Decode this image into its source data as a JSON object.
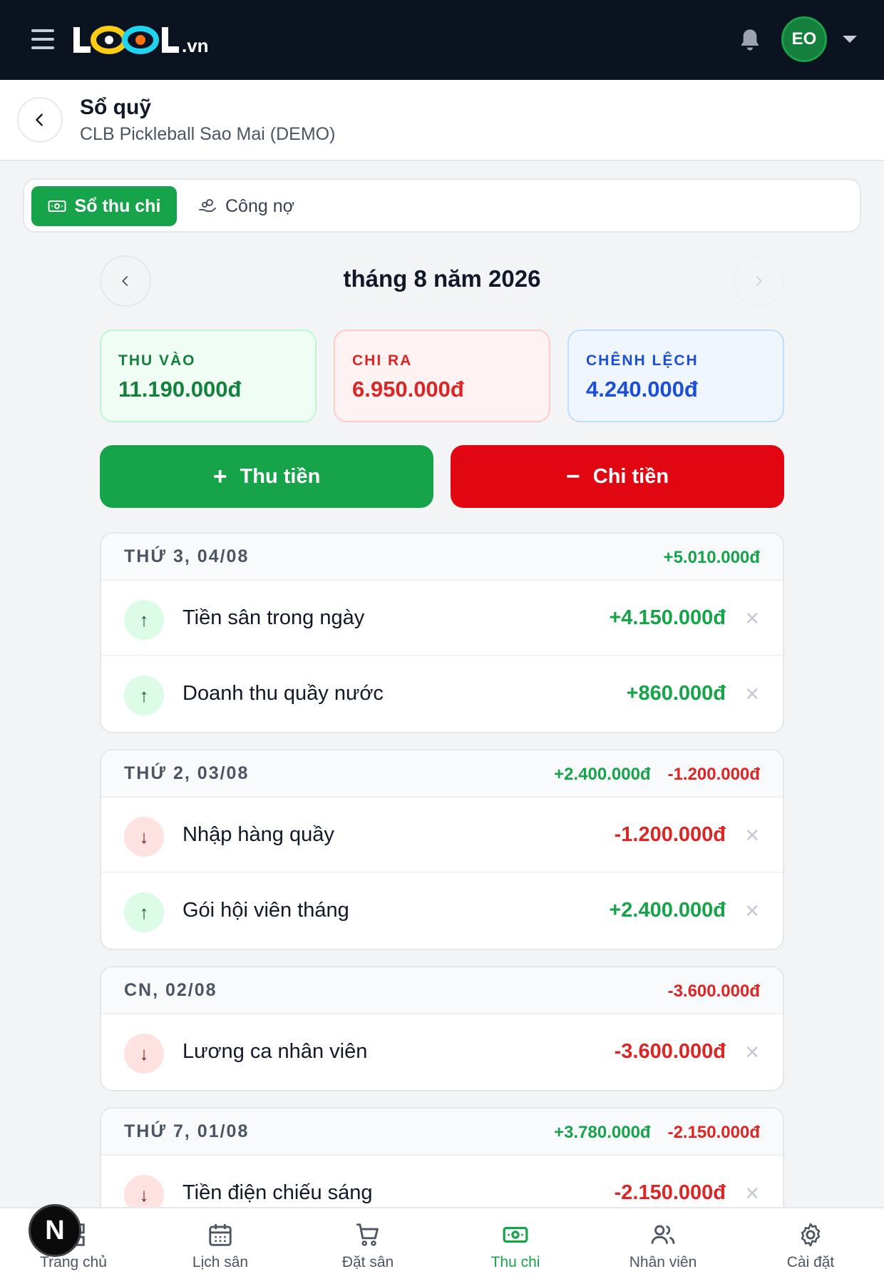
{
  "topbar": {
    "logo_text": "LOOL",
    "logo_suffix": ".vn",
    "avatar_initials": "EO"
  },
  "header": {
    "title": "Sổ quỹ",
    "subtitle": "CLB Pickleball Sao Mai (DEMO)"
  },
  "tabs": [
    {
      "label": "Sổ thu chi",
      "active": true,
      "icon": "cash-icon"
    },
    {
      "label": "Công nợ",
      "active": false,
      "icon": "hand-coins-icon"
    }
  ],
  "month": {
    "label": "tháng 8 năm 2026"
  },
  "summary": {
    "income_label": "THU VÀO",
    "income_value": "11.190.000đ",
    "expense_label": "CHI RA",
    "expense_value": "6.950.000đ",
    "diff_label": "CHÊNH LỆCH",
    "diff_value": "4.240.000đ"
  },
  "actions": {
    "income_sign": "+",
    "income_label": "Thu tiền",
    "expense_sign": "−",
    "expense_label": "Chi tiền"
  },
  "days": [
    {
      "date": "THỨ 3, 04/08",
      "income_total": "+5.010.000đ",
      "expense_total": "",
      "transactions": [
        {
          "direction": "up",
          "title": "Tiền sân trong ngày",
          "amount": "+4.150.000đ"
        },
        {
          "direction": "up",
          "title": "Doanh thu quầy nước",
          "amount": "+860.000đ"
        }
      ]
    },
    {
      "date": "THỨ 2, 03/08",
      "income_total": "+2.400.000đ",
      "expense_total": "-1.200.000đ",
      "transactions": [
        {
          "direction": "down",
          "title": "Nhập hàng quầy",
          "amount": "-1.200.000đ"
        },
        {
          "direction": "up",
          "title": "Gói hội viên tháng",
          "amount": "+2.400.000đ"
        }
      ]
    },
    {
      "date": "CN, 02/08",
      "income_total": "",
      "expense_total": "-3.600.000đ",
      "transactions": [
        {
          "direction": "down",
          "title": "Lương ca nhân viên",
          "amount": "-3.600.000đ"
        }
      ]
    },
    {
      "date": "THỨ 7, 01/08",
      "income_total": "+3.780.000đ",
      "expense_total": "-2.150.000đ",
      "transactions": [
        {
          "direction": "down",
          "title": "Tiền điện chiếu sáng",
          "amount": "-2.150.000đ"
        }
      ]
    }
  ],
  "bottom_nav": [
    {
      "label": "Trang chủ",
      "icon": "home-icon",
      "active": false
    },
    {
      "label": "Lịch sân",
      "icon": "calendar-icon",
      "active": false
    },
    {
      "label": "Đặt sân",
      "icon": "cart-icon",
      "active": false
    },
    {
      "label": "Thu chi",
      "icon": "cash-icon",
      "active": true
    },
    {
      "label": "Nhân viên",
      "icon": "users-icon",
      "active": false
    },
    {
      "label": "Cài đặt",
      "icon": "gear-icon",
      "active": false
    }
  ],
  "fab_letter": "N",
  "colors": {
    "topbar": "#0b1220",
    "brand_green": "#16a34a",
    "danger_red": "#e00712",
    "info_blue": "#1d4ed8"
  }
}
